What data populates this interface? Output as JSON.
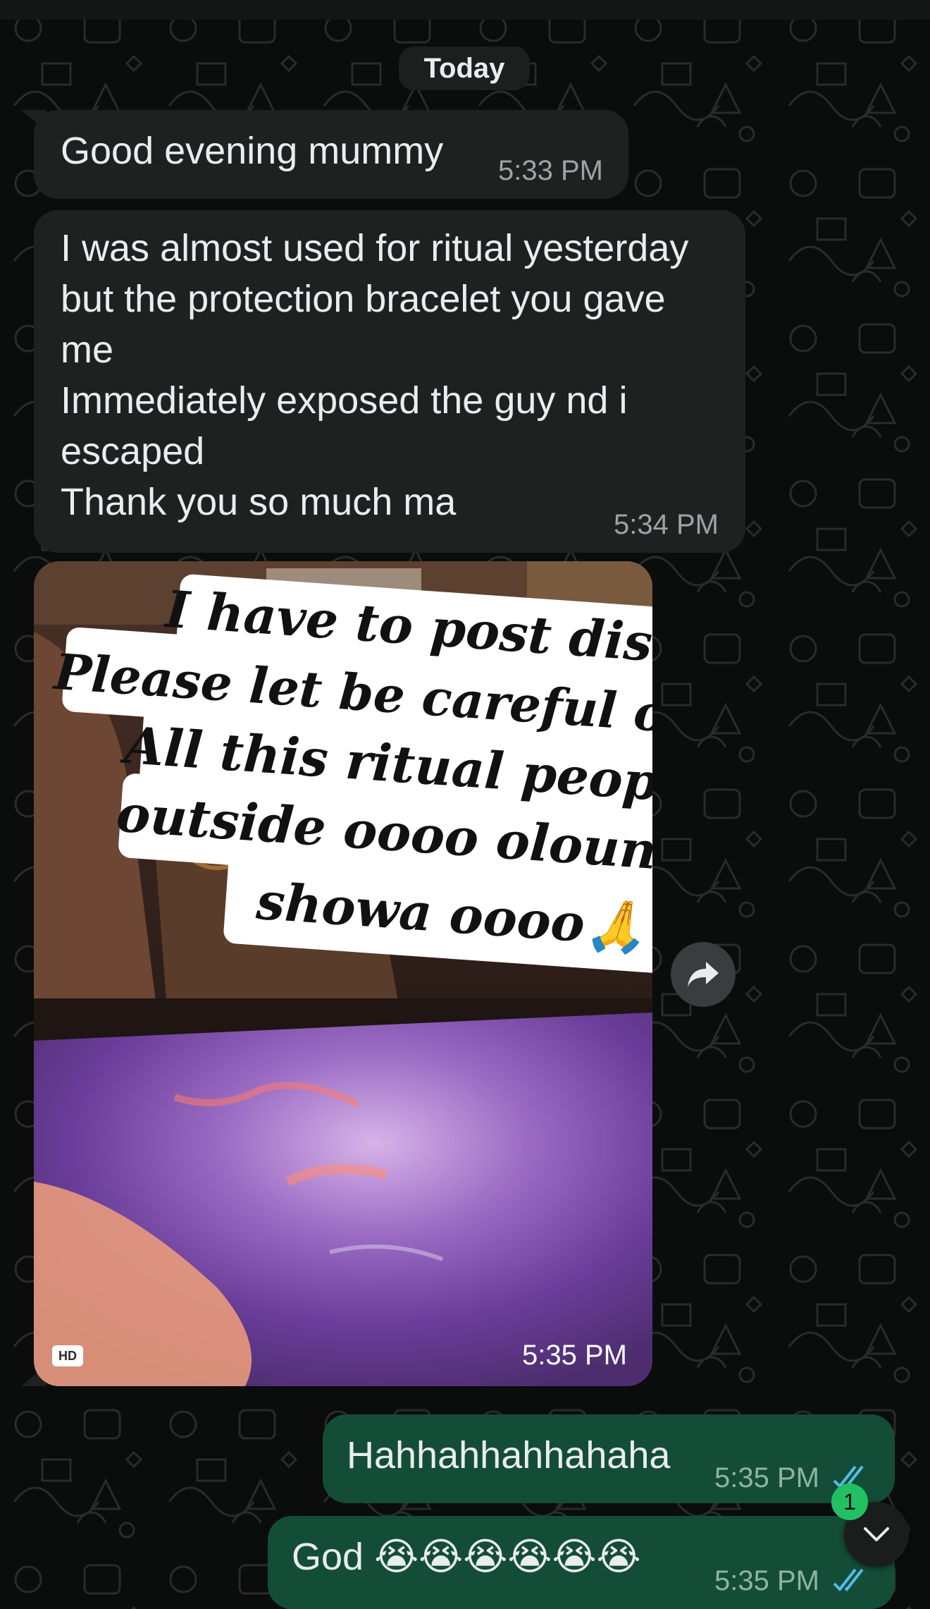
{
  "date_divider": "Today",
  "messages": [
    {
      "direction": "incoming",
      "text": "Good evening mummy",
      "time": "5:33 PM"
    },
    {
      "direction": "incoming",
      "lines": [
        "I was almost used for ritual yesterday",
        "but the protection bracelet you gave",
        "me",
        "Immediately exposed the guy nd i",
        "escaped",
        "Thank you so much ma"
      ],
      "time": "5:34 PM"
    },
    {
      "direction": "incoming",
      "type": "image",
      "caption_lines": [
        "I have to post dis here",
        "Please let be careful out there",
        "All this ritual people are",
        "outside oooo oloun ama",
        "showa oooo🙏"
      ],
      "hd_label": "HD",
      "time": "5:35 PM"
    },
    {
      "direction": "outgoing",
      "text": "Hahhahhahhahaha",
      "time": "5:35 PM",
      "status": "read"
    },
    {
      "direction": "outgoing",
      "text": "God 😭😭😭😭😭😭",
      "time": "5:35 PM",
      "status": "read"
    }
  ],
  "scroll_button": {
    "icon": "chevron-down-icon",
    "unread_count": "1"
  },
  "colors": {
    "incoming_bubble": "#1f2121",
    "outgoing_bubble": "#144d37",
    "read_ticks": "#53bdeb",
    "unread_badge": "#21c063"
  }
}
